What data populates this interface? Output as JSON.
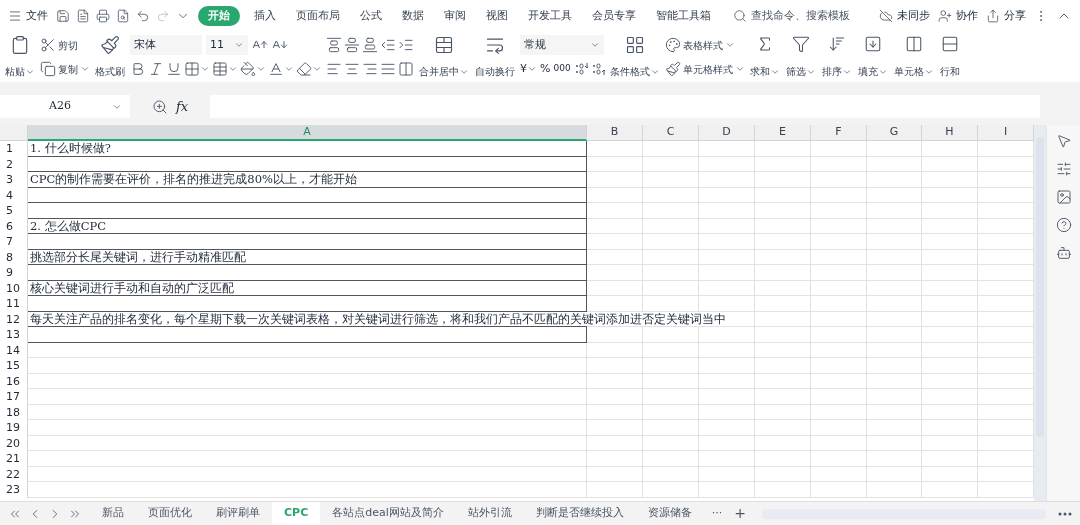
{
  "menu": {
    "file": "文件",
    "tabs": [
      {
        "label": "开始",
        "selected": true
      },
      {
        "label": "插入",
        "selected": false
      },
      {
        "label": "页面布局",
        "selected": false
      },
      {
        "label": "公式",
        "selected": false
      },
      {
        "label": "数据",
        "selected": false
      },
      {
        "label": "审阅",
        "selected": false
      },
      {
        "label": "视图",
        "selected": false
      },
      {
        "label": "开发工具",
        "selected": false
      },
      {
        "label": "会员专享",
        "selected": false
      },
      {
        "label": "智能工具箱",
        "selected": false
      }
    ],
    "search_placeholder": "查找命令、搜索模板",
    "sync": "未同步",
    "collaborate": "协作",
    "share": "分享"
  },
  "ribbon": {
    "clipboard": {
      "paste": "粘贴",
      "cut": "剪切",
      "copy": "复制",
      "format_painter": "格式刷"
    },
    "font": {
      "name": "宋体",
      "size": "11"
    },
    "alignment": {
      "merge": "合并居中",
      "wrap": "自动换行"
    },
    "number": {
      "format": "常规",
      "currency": "¥",
      "percent": "%",
      "thousands": "000"
    },
    "styles": {
      "conditional": "条件格式",
      "table_style": "表格样式",
      "cell_style": "单元格样式"
    },
    "editing": [
      {
        "kind": "sum",
        "label": "求和"
      },
      {
        "kind": "filter",
        "label": "筛选"
      },
      {
        "kind": "sort",
        "label": "排序"
      },
      {
        "kind": "fill",
        "label": "填充"
      },
      {
        "kind": "cell",
        "label": "单元格"
      },
      {
        "kind": "rowcol",
        "label": "行和"
      }
    ]
  },
  "formula_bar": {
    "name_box": "A26",
    "fx": "fx"
  },
  "columns": [
    {
      "label": "A",
      "selected": true
    },
    {
      "label": "B",
      "selected": false
    },
    {
      "label": "C",
      "selected": false
    },
    {
      "label": "D",
      "selected": false
    },
    {
      "label": "E",
      "selected": false
    },
    {
      "label": "F",
      "selected": false
    },
    {
      "label": "G",
      "selected": false
    },
    {
      "label": "H",
      "selected": false
    },
    {
      "label": "I",
      "selected": false
    }
  ],
  "rows": [
    {
      "number": "1",
      "a": "1. 什么时候做?"
    },
    {
      "number": "2"
    },
    {
      "number": "3",
      "a": "CPC的制作需要在评价，排名的推进完成80%以上，才能开始"
    },
    {
      "number": "4"
    },
    {
      "number": "5"
    },
    {
      "number": "6",
      "a": "2. 怎么做CPC"
    },
    {
      "number": "7"
    },
    {
      "number": "8",
      "a": "挑选部分长尾关键词，进行手动精准匹配"
    },
    {
      "number": "9"
    },
    {
      "number": "10",
      "a": "核心关键词进行手动和自动的广泛匹配"
    },
    {
      "number": "11"
    },
    {
      "number": "12",
      "a": "每天关注产品的排名变化，每个星期下载一次关键词表格，对关键词进行筛选，将和我们产品不匹配的关键词添加进否定关键词当中"
    },
    {
      "number": "13"
    },
    {
      "number": "14"
    },
    {
      "number": "15"
    },
    {
      "number": "16"
    },
    {
      "number": "17"
    },
    {
      "number": "18"
    },
    {
      "number": "19"
    },
    {
      "number": "20"
    },
    {
      "number": "21"
    },
    {
      "number": "22"
    },
    {
      "number": "23"
    }
  ],
  "sheet_tabs": [
    {
      "label": "新品",
      "selected": false
    },
    {
      "label": "页面优化",
      "selected": false
    },
    {
      "label": "刷评刷单",
      "selected": false
    },
    {
      "label": "CPC",
      "selected": true
    },
    {
      "label": "各站点deal网站及简介",
      "selected": false
    },
    {
      "label": "站外引流",
      "selected": false
    },
    {
      "label": "判断是否继续投入",
      "selected": false
    },
    {
      "label": "资源储备",
      "selected": false
    }
  ],
  "more_tabs": "···",
  "add_tab": "+"
}
